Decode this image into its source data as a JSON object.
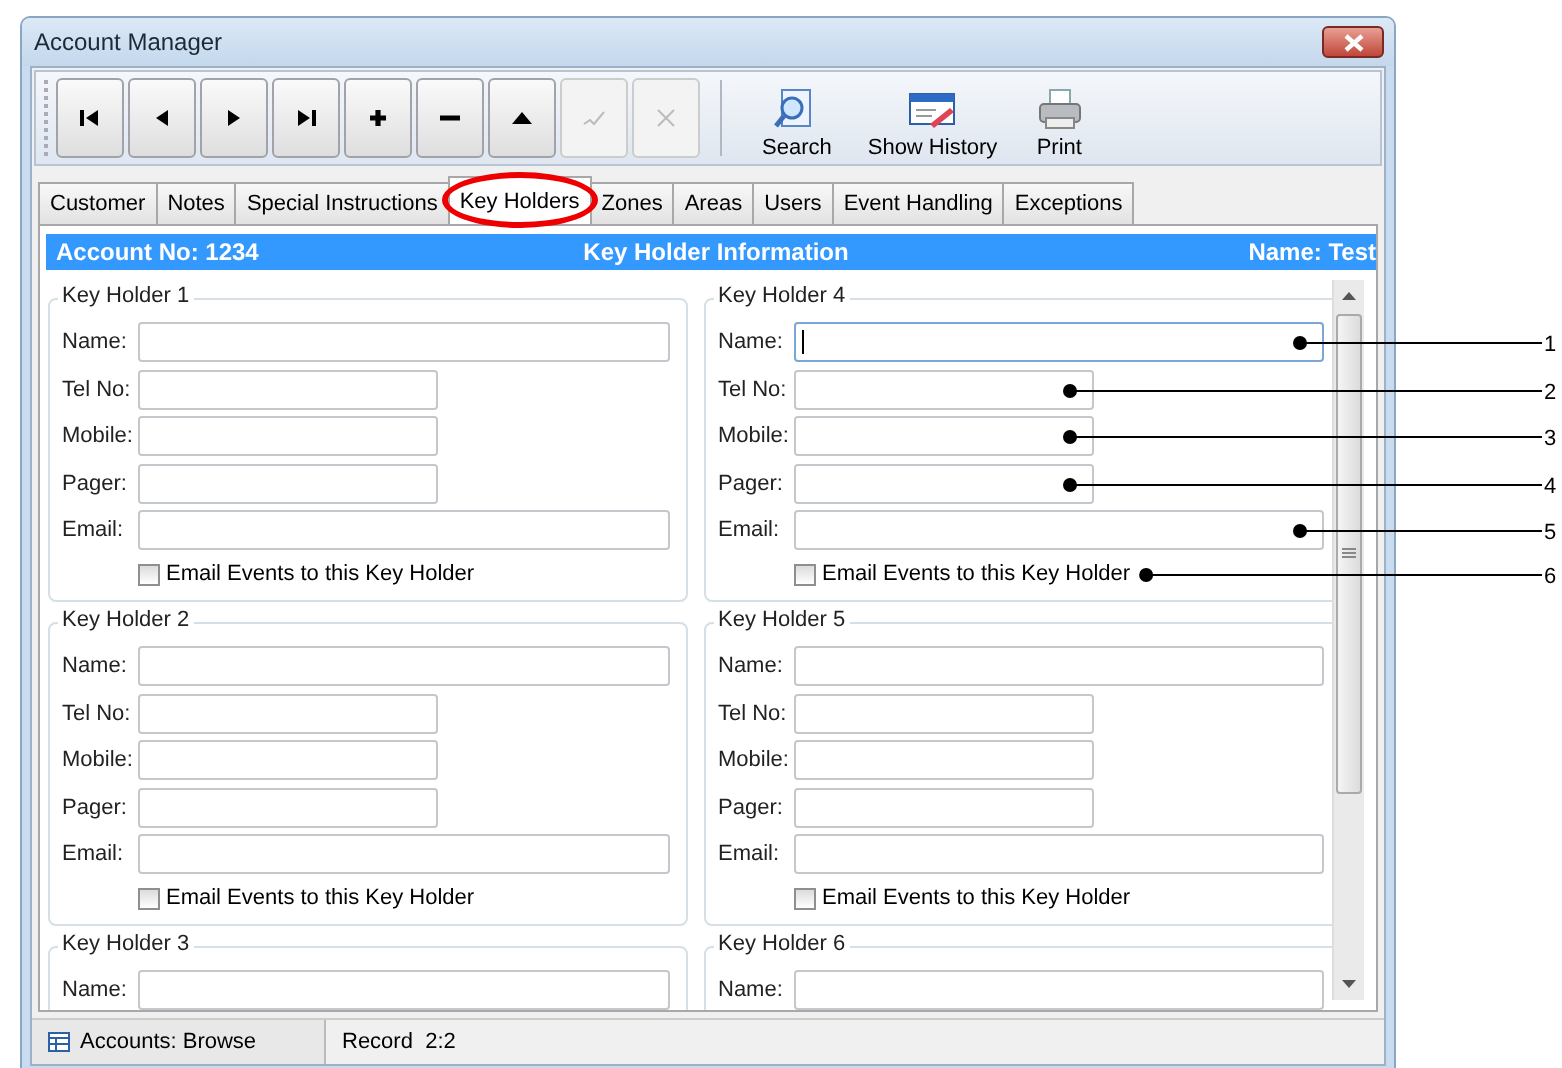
{
  "window": {
    "title": "Account Manager"
  },
  "toolbar": {
    "nav": [
      {
        "kind": "first",
        "disabled": false
      },
      {
        "kind": "prev",
        "disabled": false
      },
      {
        "kind": "next",
        "disabled": false
      },
      {
        "kind": "last",
        "disabled": false
      },
      {
        "kind": "add",
        "disabled": false
      },
      {
        "kind": "delete",
        "disabled": false
      },
      {
        "kind": "edit",
        "disabled": false
      },
      {
        "kind": "post",
        "disabled": true
      },
      {
        "kind": "cancel",
        "disabled": true
      }
    ],
    "tools": [
      {
        "kind": "search",
        "label": "Search"
      },
      {
        "kind": "history",
        "label": "Show History"
      },
      {
        "kind": "print",
        "label": "Print"
      }
    ]
  },
  "tabs": [
    {
      "label": "Customer",
      "selected": false,
      "circled": false
    },
    {
      "label": "Notes",
      "selected": false,
      "circled": false
    },
    {
      "label": "Special Instructions",
      "selected": false,
      "circled": false
    },
    {
      "label": "Key Holders",
      "selected": true,
      "circled": true
    },
    {
      "label": "Zones",
      "selected": false,
      "circled": false
    },
    {
      "label": "Areas",
      "selected": false,
      "circled": false
    },
    {
      "label": "Users",
      "selected": false,
      "circled": false
    },
    {
      "label": "Event Handling",
      "selected": false,
      "circled": false
    },
    {
      "label": "Exceptions",
      "selected": false,
      "circled": false
    }
  ],
  "header": {
    "account": "Account No: 1234",
    "title": "Key Holder Information",
    "name": "Name: Test"
  },
  "key_holders": [
    {
      "title": "Key Holder 1",
      "fields": [
        {
          "kind": "name",
          "label": "Name:",
          "focused": false
        },
        {
          "kind": "tel",
          "label": "Tel No:",
          "focused": false
        },
        {
          "kind": "mobile",
          "label": "Mobile:",
          "focused": false
        },
        {
          "kind": "pager",
          "label": "Pager:",
          "focused": false
        },
        {
          "kind": "email",
          "label": "Email:",
          "focused": false
        }
      ],
      "checkbox": {
        "label": "Email Events to this Key Holder",
        "checked": false
      }
    },
    {
      "title": "Key Holder 4",
      "fields": [
        {
          "kind": "name",
          "label": "Name:",
          "focused": true
        },
        {
          "kind": "tel",
          "label": "Tel No:",
          "focused": false
        },
        {
          "kind": "mobile",
          "label": "Mobile:",
          "focused": false
        },
        {
          "kind": "pager",
          "label": "Pager:",
          "focused": false
        },
        {
          "kind": "email",
          "label": "Email:",
          "focused": false
        }
      ],
      "checkbox": {
        "label": "Email Events to this Key Holder",
        "checked": false
      }
    },
    {
      "title": "Key Holder 2",
      "fields": [
        {
          "kind": "name",
          "label": "Name:",
          "focused": false
        },
        {
          "kind": "tel",
          "label": "Tel No:",
          "focused": false
        },
        {
          "kind": "mobile",
          "label": "Mobile:",
          "focused": false
        },
        {
          "kind": "pager",
          "label": "Pager:",
          "focused": false
        },
        {
          "kind": "email",
          "label": "Email:",
          "focused": false
        }
      ],
      "checkbox": {
        "label": "Email Events to this Key Holder",
        "checked": false
      }
    },
    {
      "title": "Key Holder 5",
      "fields": [
        {
          "kind": "name",
          "label": "Name:",
          "focused": false
        },
        {
          "kind": "tel",
          "label": "Tel No:",
          "focused": false
        },
        {
          "kind": "mobile",
          "label": "Mobile:",
          "focused": false
        },
        {
          "kind": "pager",
          "label": "Pager:",
          "focused": false
        },
        {
          "kind": "email",
          "label": "Email:",
          "focused": false
        }
      ],
      "checkbox": {
        "label": "Email Events to this Key Holder",
        "checked": false
      }
    },
    {
      "title": "Key Holder 3",
      "fields": [
        {
          "kind": "name",
          "label": "Name:",
          "focused": false
        }
      ]
    },
    {
      "title": "Key Holder 6",
      "fields": [
        {
          "kind": "name",
          "label": "Name:",
          "focused": false
        }
      ]
    }
  ],
  "callouts": [
    {
      "number": "1"
    },
    {
      "number": "2"
    },
    {
      "number": "3"
    },
    {
      "number": "4"
    },
    {
      "number": "5"
    },
    {
      "number": "6"
    }
  ],
  "status_bar": {
    "mode": "Accounts: Browse",
    "record": "Record  2:2"
  }
}
